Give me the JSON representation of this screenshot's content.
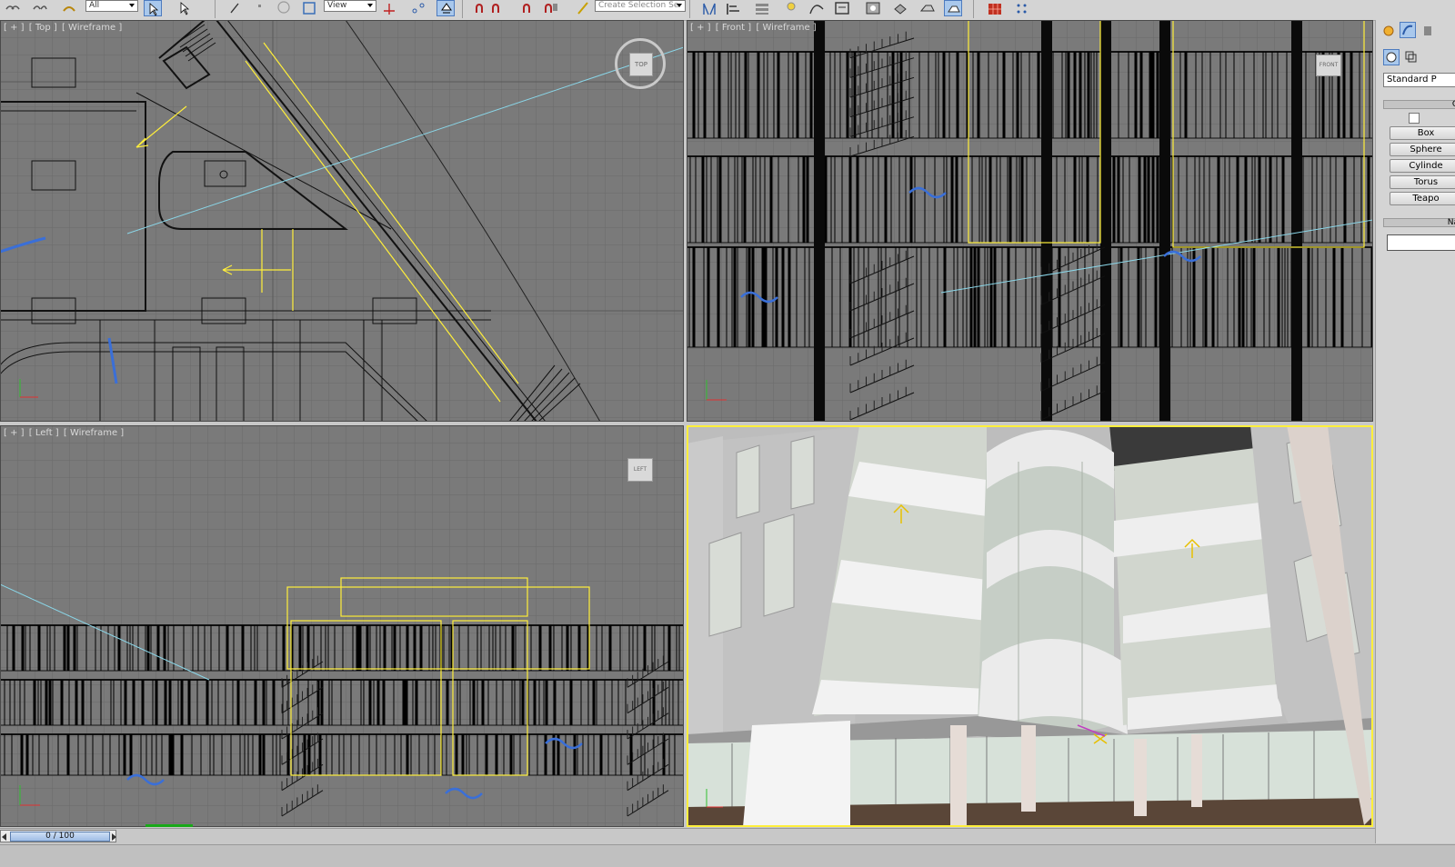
{
  "toolbar": {
    "selection_filter": "All",
    "reference_coord": "View",
    "named_selection_placeholder": "Create Selection Se"
  },
  "viewports": {
    "top": {
      "label_plus": "[ + ]",
      "label_view": "[ Top ]",
      "label_shading": "[ Wireframe ]",
      "cube_face": "TOP"
    },
    "front": {
      "label_plus": "[ + ]",
      "label_view": "[ Front ]",
      "label_shading": "[ Wireframe ]",
      "cube_face": "FRONT"
    },
    "left": {
      "label_plus": "[ + ]",
      "label_view": "[ Left ]",
      "label_shading": "[ Wireframe ]",
      "cube_face": "LEFT"
    },
    "perspective": {
      "active": true
    }
  },
  "command_panel": {
    "category": "Standard P",
    "rollout_object_type": "O",
    "primitives": [
      "Box",
      "Sphere",
      "Cylinde",
      "Torus",
      "Teapo"
    ],
    "rollout_name": "Na"
  },
  "time_slider": {
    "label": "0 / 100",
    "current": 0,
    "total": 100
  },
  "colors": {
    "viewport_bg": "#7a7a7a",
    "grid": "#6c6c6c",
    "selection": "#ffef3a",
    "active_border": "#ffef3a"
  }
}
